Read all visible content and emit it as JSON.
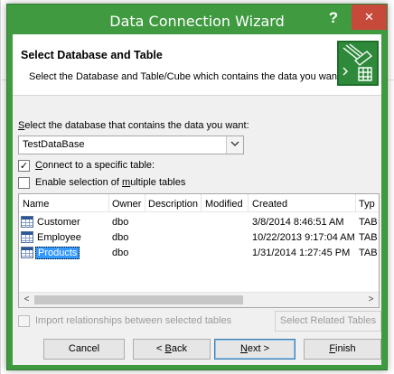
{
  "window": {
    "title": "Data Connection Wizard",
    "help": "?",
    "close": "✕"
  },
  "header": {
    "title": "Select Database and Table",
    "subtitle": "Select the Database and Table/Cube which contains the data you want."
  },
  "database": {
    "label_pre": "S",
    "label_rest": "elect the database that contains the data you want:",
    "value": "TestDataBase",
    "dropdown_arrow": "⌵"
  },
  "connect_specific": {
    "label_pre": "C",
    "label_rest": "onnect to a specific table:",
    "checked": true,
    "mark": "✓"
  },
  "enable_multiple": {
    "label_pre": "Enable selection of ",
    "label_u": "m",
    "label_rest": "ultiple tables",
    "checked": false
  },
  "table": {
    "columns": [
      "Name",
      "Owner",
      "Description",
      "Modified",
      "Created",
      "Type"
    ],
    "columns_visible": [
      "Name",
      "Owner",
      "Description",
      "Modified",
      "Created",
      "Typ"
    ],
    "rows": [
      {
        "name": "Customer",
        "owner": "dbo",
        "description": "",
        "modified": "",
        "created": "3/8/2014 8:46:51 AM",
        "type": "TAB"
      },
      {
        "name": "Employee",
        "owner": "dbo",
        "description": "",
        "modified": "",
        "created": "10/22/2013 9:17:04 AM",
        "type": "TAB"
      },
      {
        "name": "Products",
        "owner": "dbo",
        "description": "",
        "modified": "",
        "created": "1/31/2014 1:27:45 PM",
        "type": "TAB",
        "selected": true
      }
    ],
    "scroll_left": "<",
    "scroll_right": ">"
  },
  "import_relationships": {
    "label": "Import relationships between selected tables",
    "enabled": false
  },
  "buttons": {
    "select_related": "Select Related Tables",
    "cancel": "Cancel",
    "back_pre": "< ",
    "back_u": "B",
    "back_rest": "ack",
    "next_u": "N",
    "next_rest": "ext >",
    "finish_u": "F",
    "finish_rest": "inish"
  },
  "colors": {
    "title_bar": "#3f9a40",
    "close_button": "#c7493a",
    "selection": "#3399ff"
  },
  "icons": {
    "wizard": "database-wizard-icon",
    "table": "table-icon"
  }
}
